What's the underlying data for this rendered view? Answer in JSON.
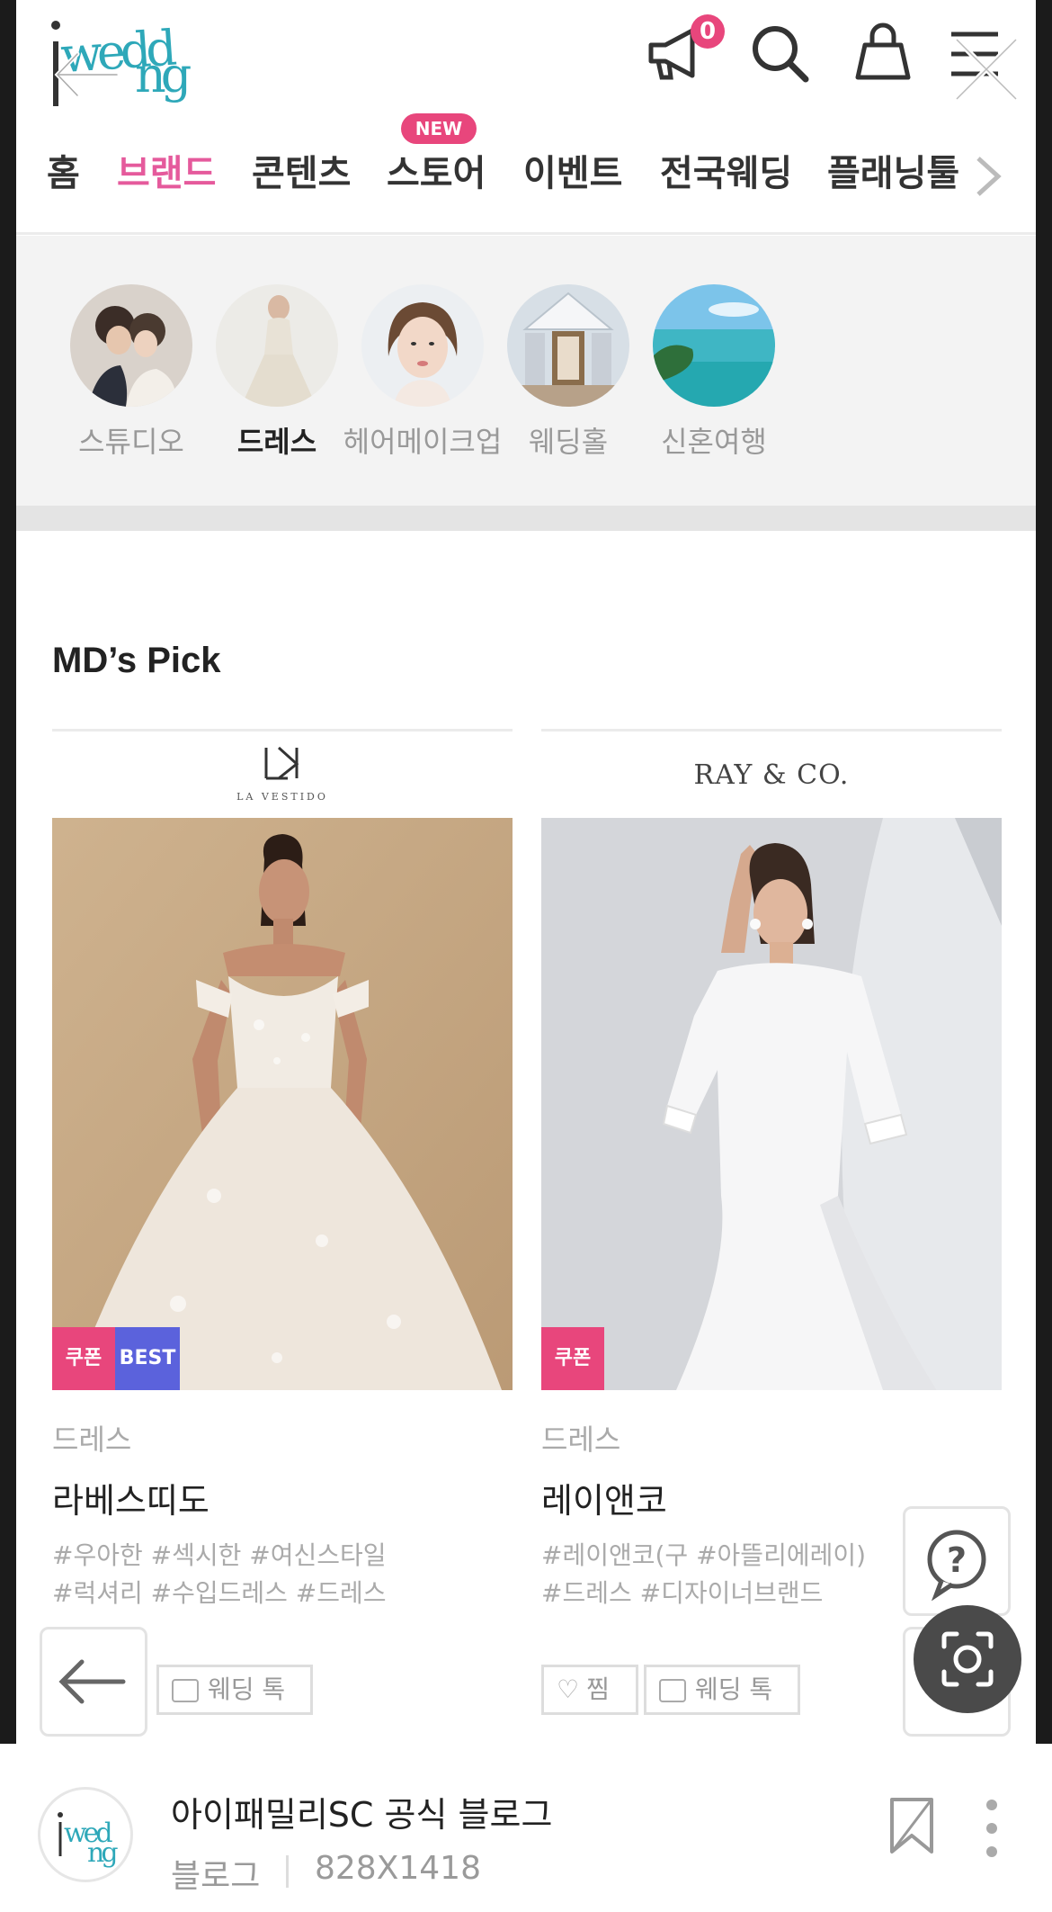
{
  "header": {
    "logo_text": "iwedding",
    "notification_count": "0"
  },
  "nav": {
    "items": [
      {
        "label": "홈"
      },
      {
        "label": "브랜드"
      },
      {
        "label": "콘텐츠"
      },
      {
        "label": "스토어"
      },
      {
        "label": "이벤트"
      },
      {
        "label": "전국웨딩"
      },
      {
        "label": "플래닝툴"
      }
    ],
    "new_badge": "NEW",
    "active_index": 1
  },
  "categories": [
    {
      "label": "스튜디오"
    },
    {
      "label": "드레스"
    },
    {
      "label": "헤어메이크업"
    },
    {
      "label": "웨딩홀"
    },
    {
      "label": "신혼여행"
    }
  ],
  "md_pick": {
    "title": "MD’s Pick",
    "cards": [
      {
        "brand_logo_text": "LA VESTIDO",
        "tags_badges": [
          "쿠폰",
          "BEST"
        ],
        "category": "드레스",
        "name": "라베스띠도",
        "hashtags_line1": "#우아한 #섹시한 #여신스타일",
        "hashtags_line2": "#럭셔리 #수입드레스 #드레스",
        "wedding_talk": "웨딩 톡"
      },
      {
        "brand_logo_text": "RAY & CO.",
        "tags_badges": [
          "쿠폰"
        ],
        "category": "드레스",
        "name": "레이앤코",
        "hashtags_line1": "#레이앤코(구 #아뜰리에레이)",
        "hashtags_line2": "#드레스 #디자이너브랜드",
        "like_label": "찜",
        "wedding_talk": "웨딩 톡"
      }
    ]
  },
  "colors": {
    "accent_pink": "#e8467c",
    "active_nav": "#e55a9c",
    "best_blue": "#5b62dc"
  },
  "blog": {
    "title": "아이패밀리SC 공식 블로그",
    "source": "블로그",
    "dimensions": "828X1418"
  }
}
